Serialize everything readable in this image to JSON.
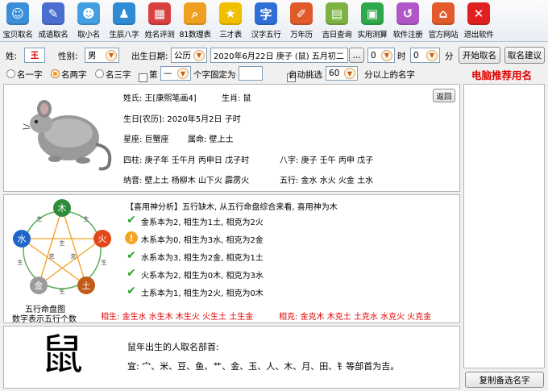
{
  "toolbar": [
    {
      "label": "宝贝取名",
      "icon": "baby-icon",
      "color": "#3b8fd8"
    },
    {
      "label": "成语取名",
      "icon": "book-icon",
      "color": "#4a6fd1"
    },
    {
      "label": "取小名",
      "icon": "people-icon",
      "color": "#42a0e0"
    },
    {
      "label": "生辰八字",
      "icon": "person-icon",
      "color": "#2e8bd6"
    },
    {
      "label": "姓名评测",
      "icon": "chart-icon",
      "color": "#d94040"
    },
    {
      "label": "81数理表",
      "icon": "magnifier-icon",
      "color": "#f0a020"
    },
    {
      "label": "三才表",
      "icon": "star-icon",
      "color": "#f0c000"
    },
    {
      "label": "汉字五行",
      "icon": "character-icon",
      "color": "#2f6ed6"
    },
    {
      "label": "万年历",
      "icon": "pencil-icon",
      "color": "#e05a2a"
    },
    {
      "label": "吉日查询",
      "icon": "calendar-icon",
      "color": "#7cb342"
    },
    {
      "label": "实用测算",
      "icon": "grid-icon",
      "color": "#2ea84a"
    },
    {
      "label": "软件注册",
      "icon": "arrow-icon",
      "color": "#b057c8"
    },
    {
      "label": "官方网站",
      "icon": "house-icon",
      "color": "#e35a2b"
    },
    {
      "label": "退出软件",
      "icon": "close-icon",
      "color": "#e02020"
    }
  ],
  "form": {
    "surname_label": "姓:",
    "surname_value": "王",
    "gender_label": "性别:",
    "gender_value": "男",
    "birth_label": "出生日期:",
    "calendar_value": "公历",
    "date_value": "2020年6月22日  庚子 (鼠) 五月初二",
    "ellipsis": "...",
    "hour_value": "0",
    "hour_unit": "时",
    "minute_value": "0",
    "minute_unit": "分",
    "start_button": "开始取名",
    "suggest_button": "取名建议"
  },
  "options": {
    "one_char": "名一字",
    "two_char": "名两字",
    "three_char": "名三字",
    "fixed_prefix": "第",
    "fixed_dash": "—",
    "fixed_suffix": "个字固定为",
    "auto_select": "自动挑选",
    "score_value": "60",
    "score_suffix": "分以上的名字"
  },
  "recommend_title": "电脑推荐用名",
  "copy_button": "复制备选名字",
  "back_button": "返回",
  "profile": {
    "surname_line": "姓氏: 王[康熙笔画4]",
    "zodiac_line": "生肖: 鼠",
    "birthday_line": "生日[农历]: 2020年5月2日  子时",
    "constellation_line": "星座: 巨蟹座",
    "fate_line": "属命: 壁上土",
    "pillars_line": "四柱: 庚子年  壬午月  丙申日  戊子时",
    "bazi_line": "八字: 庚子  壬午  丙申  戊子",
    "nayin_line": "纳音: 壁上土  杨柳木  山下火  霹雳火",
    "wuxing_line": "五行: 金水  水火  火金  土水"
  },
  "analysis": {
    "title": "【喜用神分析】五行缺木, 从五行命盘综合来看, 喜用神为木",
    "lines": [
      {
        "text": "金系本为2, 相生为1土, 相克为2火",
        "icon": "check-icon"
      },
      {
        "text": "木系本为0, 相生为3水, 相克为2金",
        "icon": "warning-icon"
      },
      {
        "text": "水系本为3, 相生为2金, 相克为1土",
        "icon": "check-icon"
      },
      {
        "text": "火系本为2, 相生为0木, 相克为3水",
        "icon": "check-icon"
      },
      {
        "text": "土系本为1, 相生为2火, 相克为0木",
        "icon": "check-icon"
      }
    ],
    "generate_line": "相生: 金生水  水生木  木生火  火生土  土生金",
    "restrain_line": "相克: 金克木  木克土  土克水  水克火  火克金",
    "chart_caption_1": "五行命盘图",
    "chart_caption_2": "数字表示五行个数",
    "chart_labels": {
      "wood": "木",
      "fire": "火",
      "earth": "土",
      "metal": "金",
      "water": "水",
      "center": "生",
      "ke": "克"
    }
  },
  "zodiac": {
    "character": "鼠",
    "line1": "鼠年出生的人取名部首:",
    "line2": "宜: 宀、米、豆、鱼、艹、金、玉、人、木、月、田、钅等部首为吉。"
  }
}
